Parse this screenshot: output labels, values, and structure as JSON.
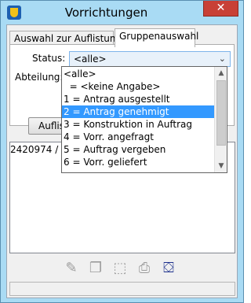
{
  "window": {
    "title": "Vorrichtungen",
    "close_glyph": "✕"
  },
  "tabs": [
    {
      "label": "Auswahl zur Auflistung"
    },
    {
      "label": "Gruppenauswahl",
      "active": true
    }
  ],
  "form": {
    "status_label": "Status:",
    "status_value": "<alle>",
    "abteilung_label": "Abteilung:",
    "list_button_label": "Auflis"
  },
  "dropdown": {
    "options": [
      "<alle>",
      "  = <keine Angabe>",
      "1 = Antrag ausgestellt",
      "2 = Antrag genehmigt",
      "3 = Konstruktion in Auftrag",
      "4 = Vorr. angefragt",
      "5 = Auftrag vergeben",
      "6 = Vorr. geliefert"
    ],
    "selected_index": 3,
    "scroll_up_glyph": "▲",
    "scroll_down_glyph": "▼"
  },
  "results": {
    "first_row": "2420974 / B"
  },
  "toolbar": {
    "buttons": [
      {
        "icon": "edit-icon",
        "glyph": "✎",
        "enabled": false
      },
      {
        "icon": "copy-icon",
        "glyph": "❐",
        "enabled": false
      },
      {
        "icon": "select-icon",
        "glyph": "⬚",
        "enabled": false
      },
      {
        "icon": "print-icon",
        "glyph": "⎙",
        "enabled": false
      },
      {
        "icon": "exit-icon",
        "glyph": "⛋",
        "enabled": true
      }
    ]
  },
  "colors": {
    "window_frame": "#a9dbf4",
    "close_button": "#c84036",
    "selection": "#3399ff",
    "combo_focus": "#7eb4ea"
  }
}
